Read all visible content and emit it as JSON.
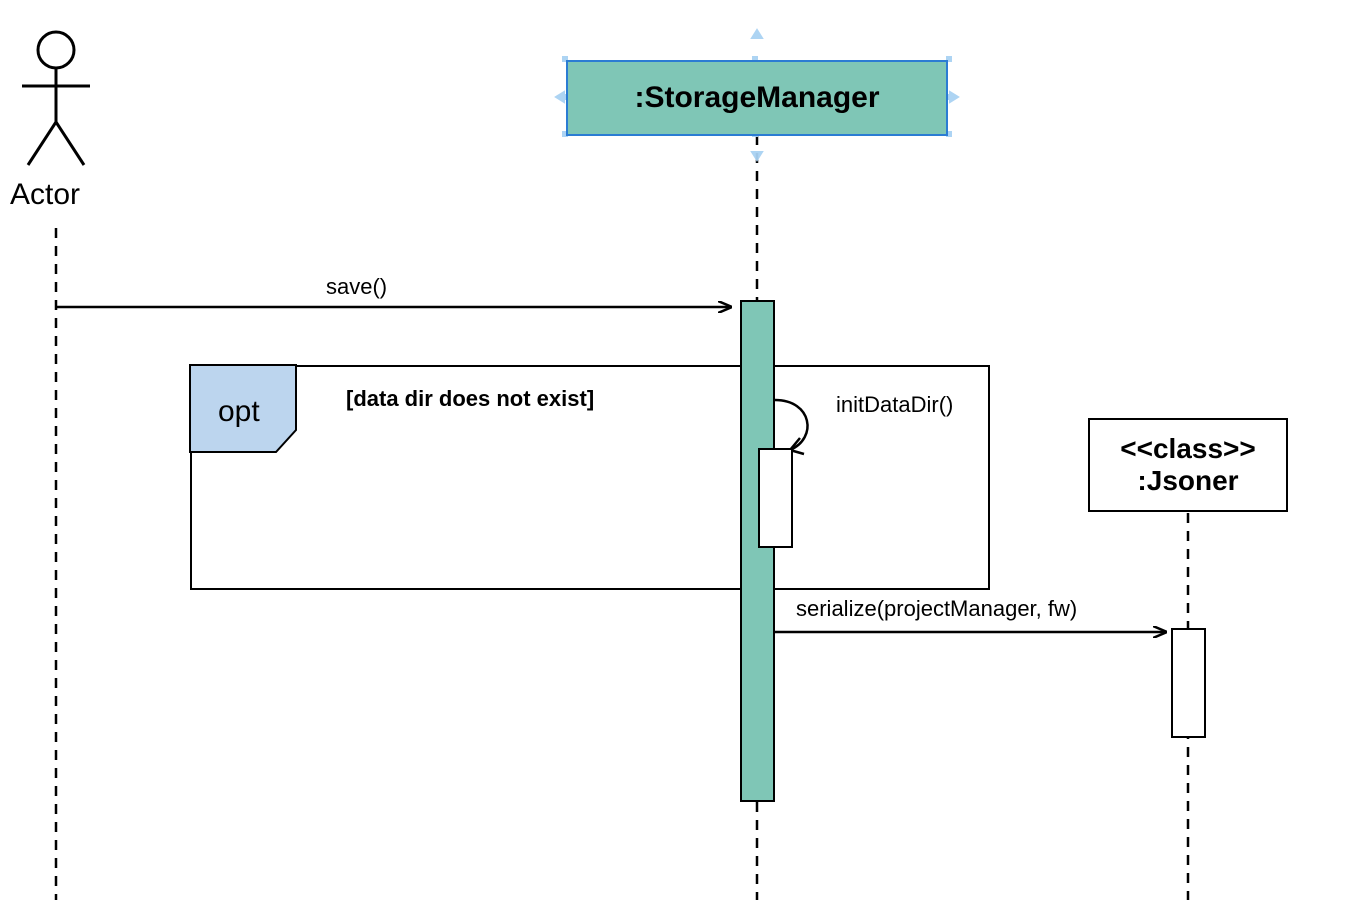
{
  "actor": {
    "label": "Actor"
  },
  "participants": {
    "storage": {
      "label": ":StorageManager"
    },
    "jsoner": {
      "stereotype": "<<class>>",
      "label": ":Jsoner"
    }
  },
  "messages": {
    "save": "save()",
    "initDataDir": "initDataDir()",
    "serialize": "serialize(projectManager, fw)"
  },
  "frame": {
    "type": "opt",
    "guard": "[data dir does not exist]"
  }
}
